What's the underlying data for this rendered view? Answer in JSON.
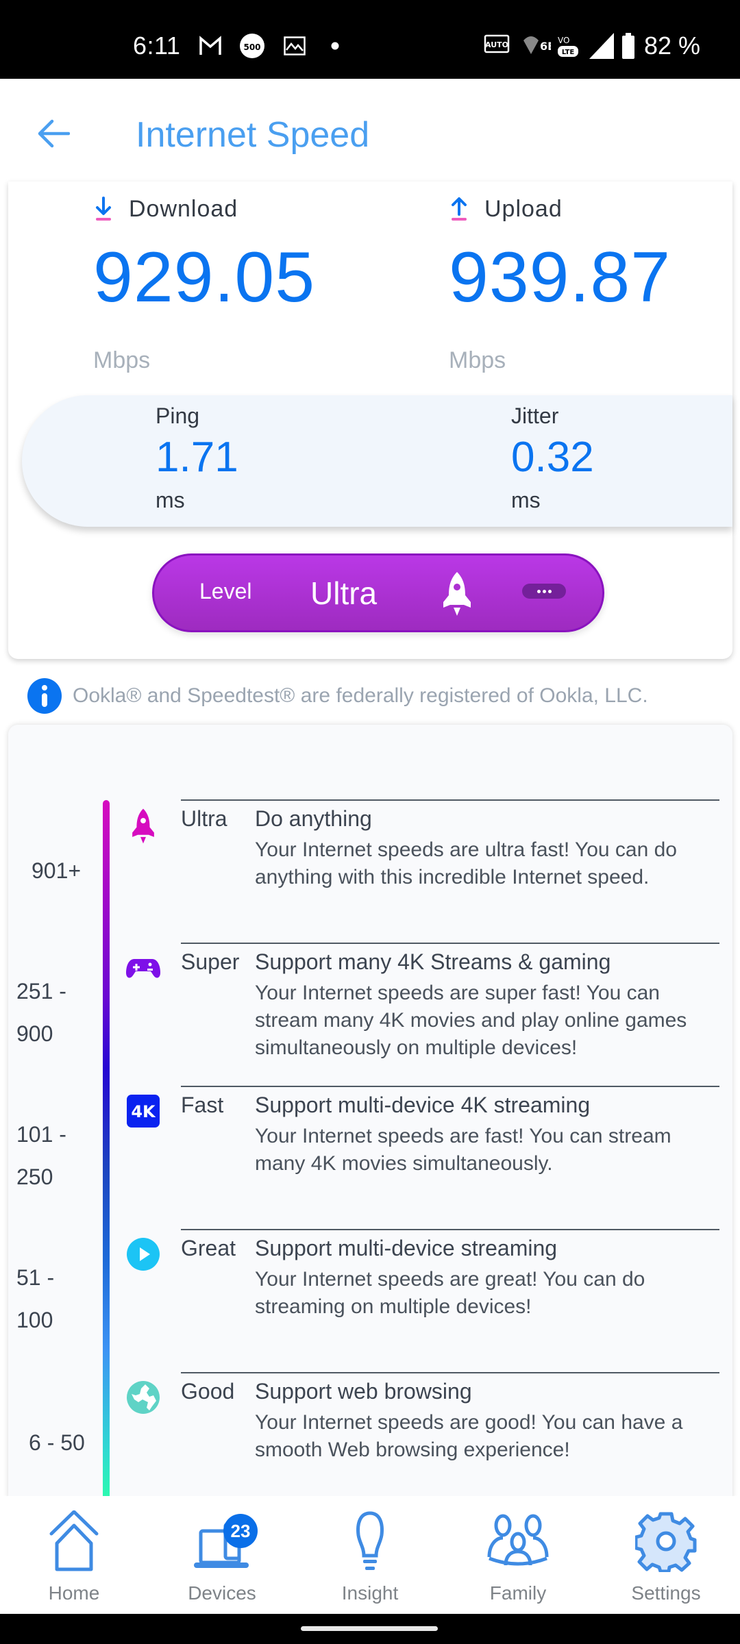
{
  "status_bar": {
    "time": "6:11",
    "left_icons": [
      "gmail-icon",
      "notification-500-icon",
      "gallery-icon",
      "dot-icon"
    ],
    "right_icons": [
      "auto-hz-icon",
      "wifi-6e-icon",
      "volte-icon",
      "cell-signal-icon",
      "battery-icon"
    ],
    "battery": "82 %"
  },
  "header": {
    "title": "Internet Speed",
    "back_icon": "arrow-left-icon"
  },
  "speed": {
    "download": {
      "label": "Download",
      "value": "929.05",
      "unit": "Mbps"
    },
    "upload": {
      "label": "Upload",
      "value": "939.87",
      "unit": "Mbps"
    },
    "ping": {
      "label": "Ping",
      "value": "1.71",
      "unit": "ms"
    },
    "jitter": {
      "label": "Jitter",
      "value": "0.32",
      "unit": "ms"
    },
    "level": {
      "label": "Level",
      "value": "Ultra",
      "icon": "rocket-icon",
      "more_icon": "more-dots-icon"
    }
  },
  "info": {
    "text": "Ookla® and Speedtest® are federally registered of Ookla, LLC."
  },
  "levels": [
    {
      "range_lines": [
        "901+"
      ],
      "name": "Ultra",
      "title": "Do anything",
      "description": "Your Internet speeds are ultra fast! You can do anything with this incredible Internet speed.",
      "icon": "rocket-icon",
      "color": "#d60cbf"
    },
    {
      "range_lines": [
        "251 -",
        "900"
      ],
      "name": "Super",
      "title": "Support many 4K Streams & gaming",
      "description": "Your Internet speeds are super fast! You can stream many 4K movies and play online games simultaneously on multiple devices!",
      "icon": "gamepad-icon",
      "color": "#7e10e8"
    },
    {
      "range_lines": [
        "101 -",
        "250"
      ],
      "name": "Fast",
      "title": "Support multi-device 4K streaming",
      "description": "Your Internet speeds are fast! You can stream many 4K movies simultaneously.",
      "icon": "4k-icon",
      "icon_text": "4K",
      "color": "#0a22f0"
    },
    {
      "range_lines": [
        "51 -",
        "100"
      ],
      "name": "Great",
      "title": "Support multi-device streaming",
      "description": "Your Internet speeds are great! You can do streaming on multiple devices!",
      "icon": "play-icon",
      "color": "#1cc4f5"
    },
    {
      "range_lines": [
        "6 - 50"
      ],
      "name": "Good",
      "title": "Support web browsing",
      "description": "Your Internet speeds are good! You can have a smooth Web browsing experience!",
      "icon": "globe-icon",
      "color": "#5fd3c6"
    }
  ],
  "bottom_nav": {
    "items": [
      {
        "label": "Home",
        "icon": "home-icon"
      },
      {
        "label": "Devices",
        "icon": "devices-icon",
        "badge": "23"
      },
      {
        "label": "Insight",
        "icon": "lightbulb-icon"
      },
      {
        "label": "Family",
        "icon": "family-icon"
      },
      {
        "label": "Settings",
        "icon": "gear-icon"
      }
    ]
  },
  "colors": {
    "accent": "#0a74f0",
    "title": "#4a9ff0",
    "level_pill": "#b032d8",
    "nav_icon": "#3f8be3"
  }
}
